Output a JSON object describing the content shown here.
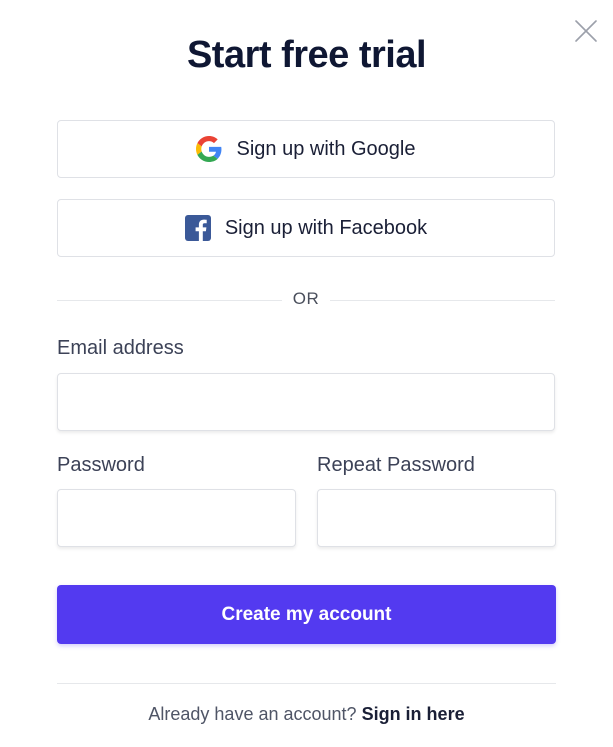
{
  "dialog": {
    "close_icon": "close-icon",
    "title": "Start free trial"
  },
  "social": {
    "google": {
      "label": "Sign up with Google",
      "icon": "google-icon"
    },
    "facebook": {
      "label": "Sign up with Facebook",
      "icon": "facebook-icon",
      "color": "#3b5998"
    }
  },
  "divider": {
    "text": "OR"
  },
  "form": {
    "email": {
      "label": "Email address",
      "value": "",
      "placeholder": ""
    },
    "password": {
      "label": "Password",
      "value": "",
      "placeholder": ""
    },
    "repeat_password": {
      "label": "Repeat Password",
      "value": "",
      "placeholder": ""
    },
    "submit_label": "Create my account",
    "accent_color": "#533af0"
  },
  "footer": {
    "prompt": "Already have an account?",
    "link": "Sign in here"
  }
}
